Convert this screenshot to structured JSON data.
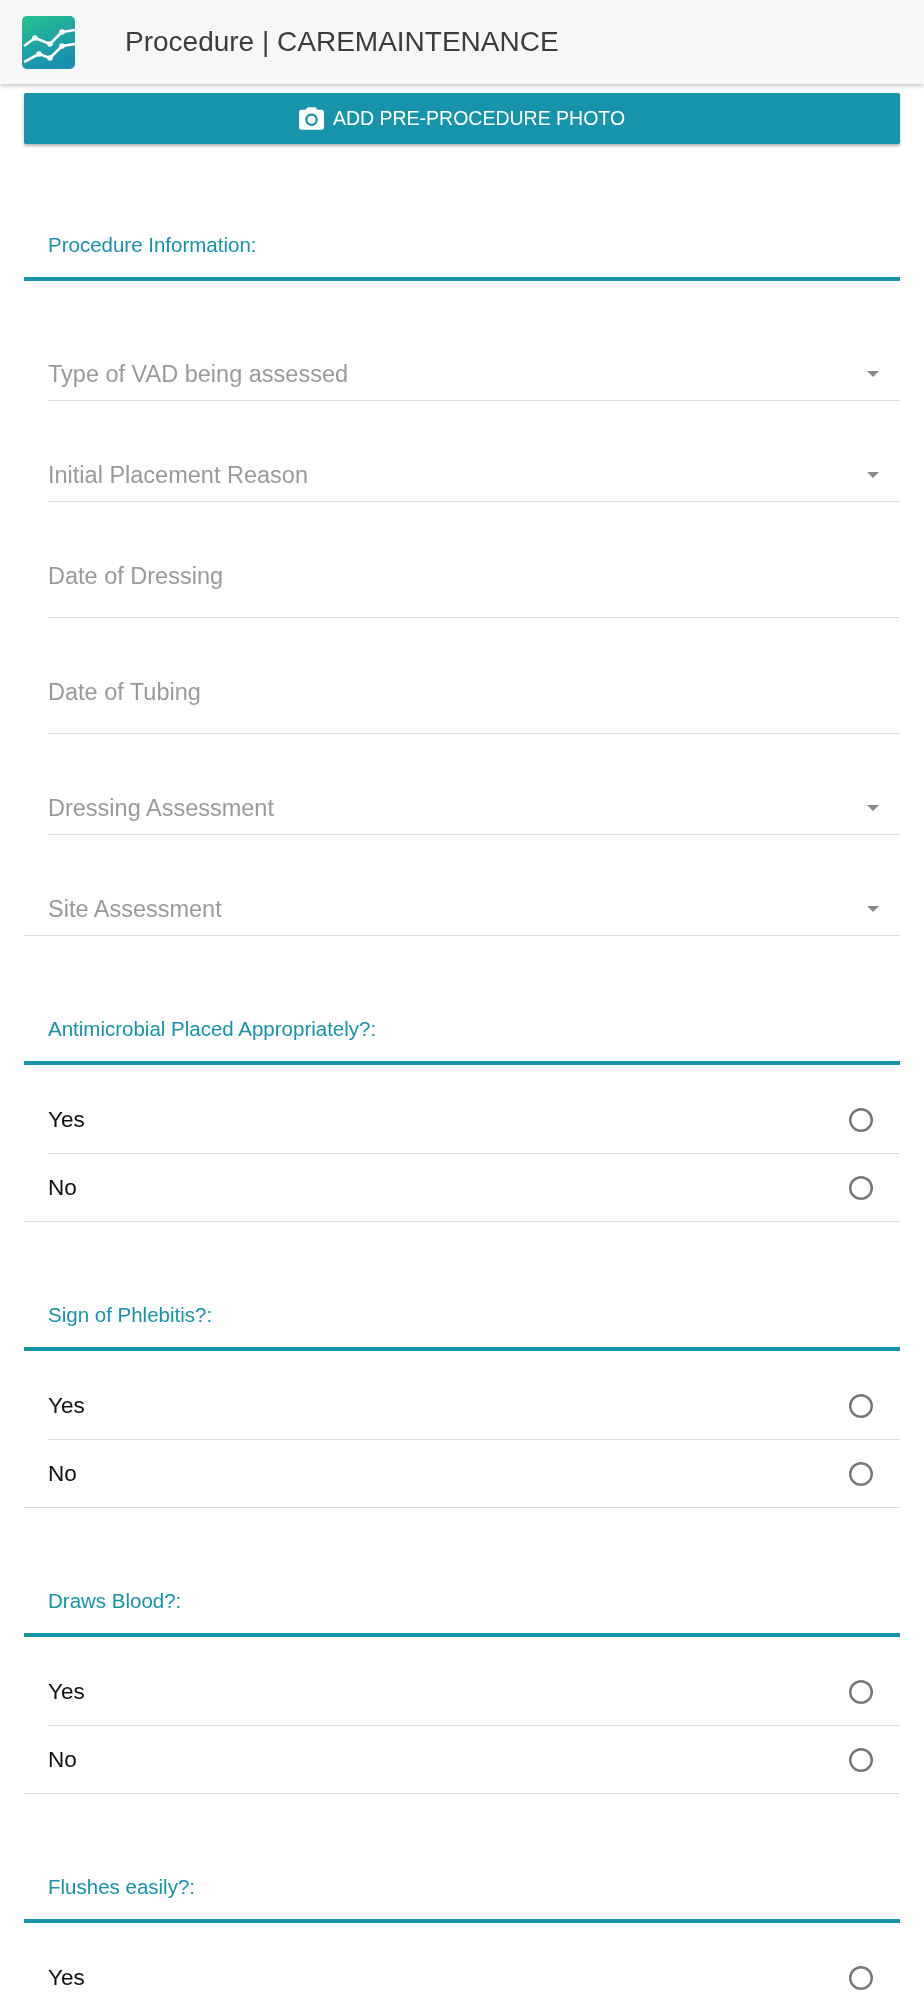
{
  "app_bar": {
    "title": "Procedure | CAREMAINTENANCE"
  },
  "photo_button": {
    "label": "ADD PRE-PROCEDURE PHOTO"
  },
  "procedure_information": {
    "heading": "Procedure Information:",
    "fields": [
      {
        "kind": "select",
        "placeholder": "Type of VAD being assessed"
      },
      {
        "kind": "select",
        "placeholder": "Initial Placement Reason"
      },
      {
        "kind": "date",
        "placeholder": "Date of Dressing"
      },
      {
        "kind": "date",
        "placeholder": "Date of Tubing"
      },
      {
        "kind": "select",
        "placeholder": "Dressing Assessment"
      },
      {
        "kind": "select",
        "placeholder": "Site Assessment"
      }
    ]
  },
  "questions": [
    {
      "heading": "Antimicrobial Placed Appropriately?:",
      "options": [
        {
          "label": "Yes",
          "selected": false
        },
        {
          "label": "No",
          "selected": false
        }
      ]
    },
    {
      "heading": "Sign of Phlebitis?:",
      "options": [
        {
          "label": "Yes",
          "selected": false
        },
        {
          "label": "No",
          "selected": false
        }
      ]
    },
    {
      "heading": "Draws Blood?:",
      "options": [
        {
          "label": "Yes",
          "selected": false
        },
        {
          "label": "No",
          "selected": false
        }
      ]
    },
    {
      "heading": "Flushes easily?:",
      "options": [
        {
          "label": "Yes",
          "selected": false
        }
      ]
    }
  ]
}
